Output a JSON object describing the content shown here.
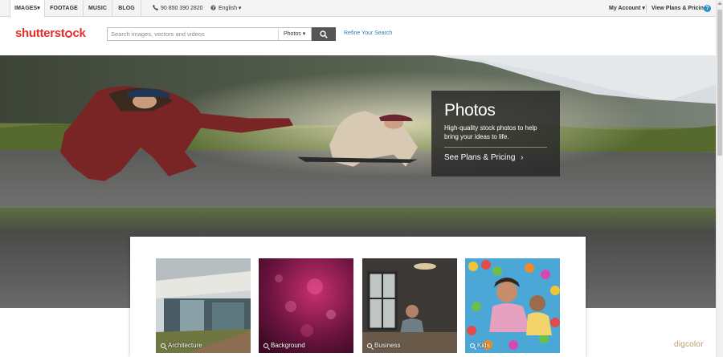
{
  "topnav": {
    "tabs": [
      {
        "label": "IMAGES▾",
        "active": true
      },
      {
        "label": "FOOTAGE",
        "active": false
      },
      {
        "label": "MUSIC",
        "active": false
      },
      {
        "label": "BLOG",
        "active": false
      }
    ],
    "phone": "90 850 390 2820",
    "language": "English ▾",
    "account": "My Account ▾",
    "plans": "View Plans & Pricing",
    "help": "?"
  },
  "header": {
    "logo_a": "shutterst",
    "logo_b": "ck",
    "search_placeholder": "Search images, vectors and videos",
    "select_value": "Photos ▾",
    "refine": "Refine Your Search"
  },
  "promo": {
    "title": "Photos",
    "text": "High-quality stock photos to help bring your ideas to life.",
    "cta": "See Plans & Pricing",
    "cta_arrow": "›"
  },
  "categories": [
    {
      "label": "Architecture"
    },
    {
      "label": "Background"
    },
    {
      "label": "Business"
    },
    {
      "label": "Kids"
    }
  ],
  "watermark": "digcolor",
  "colors": {
    "brand": "#e42f2b",
    "link": "#2b7fb8",
    "promo_bg": "#262626"
  }
}
